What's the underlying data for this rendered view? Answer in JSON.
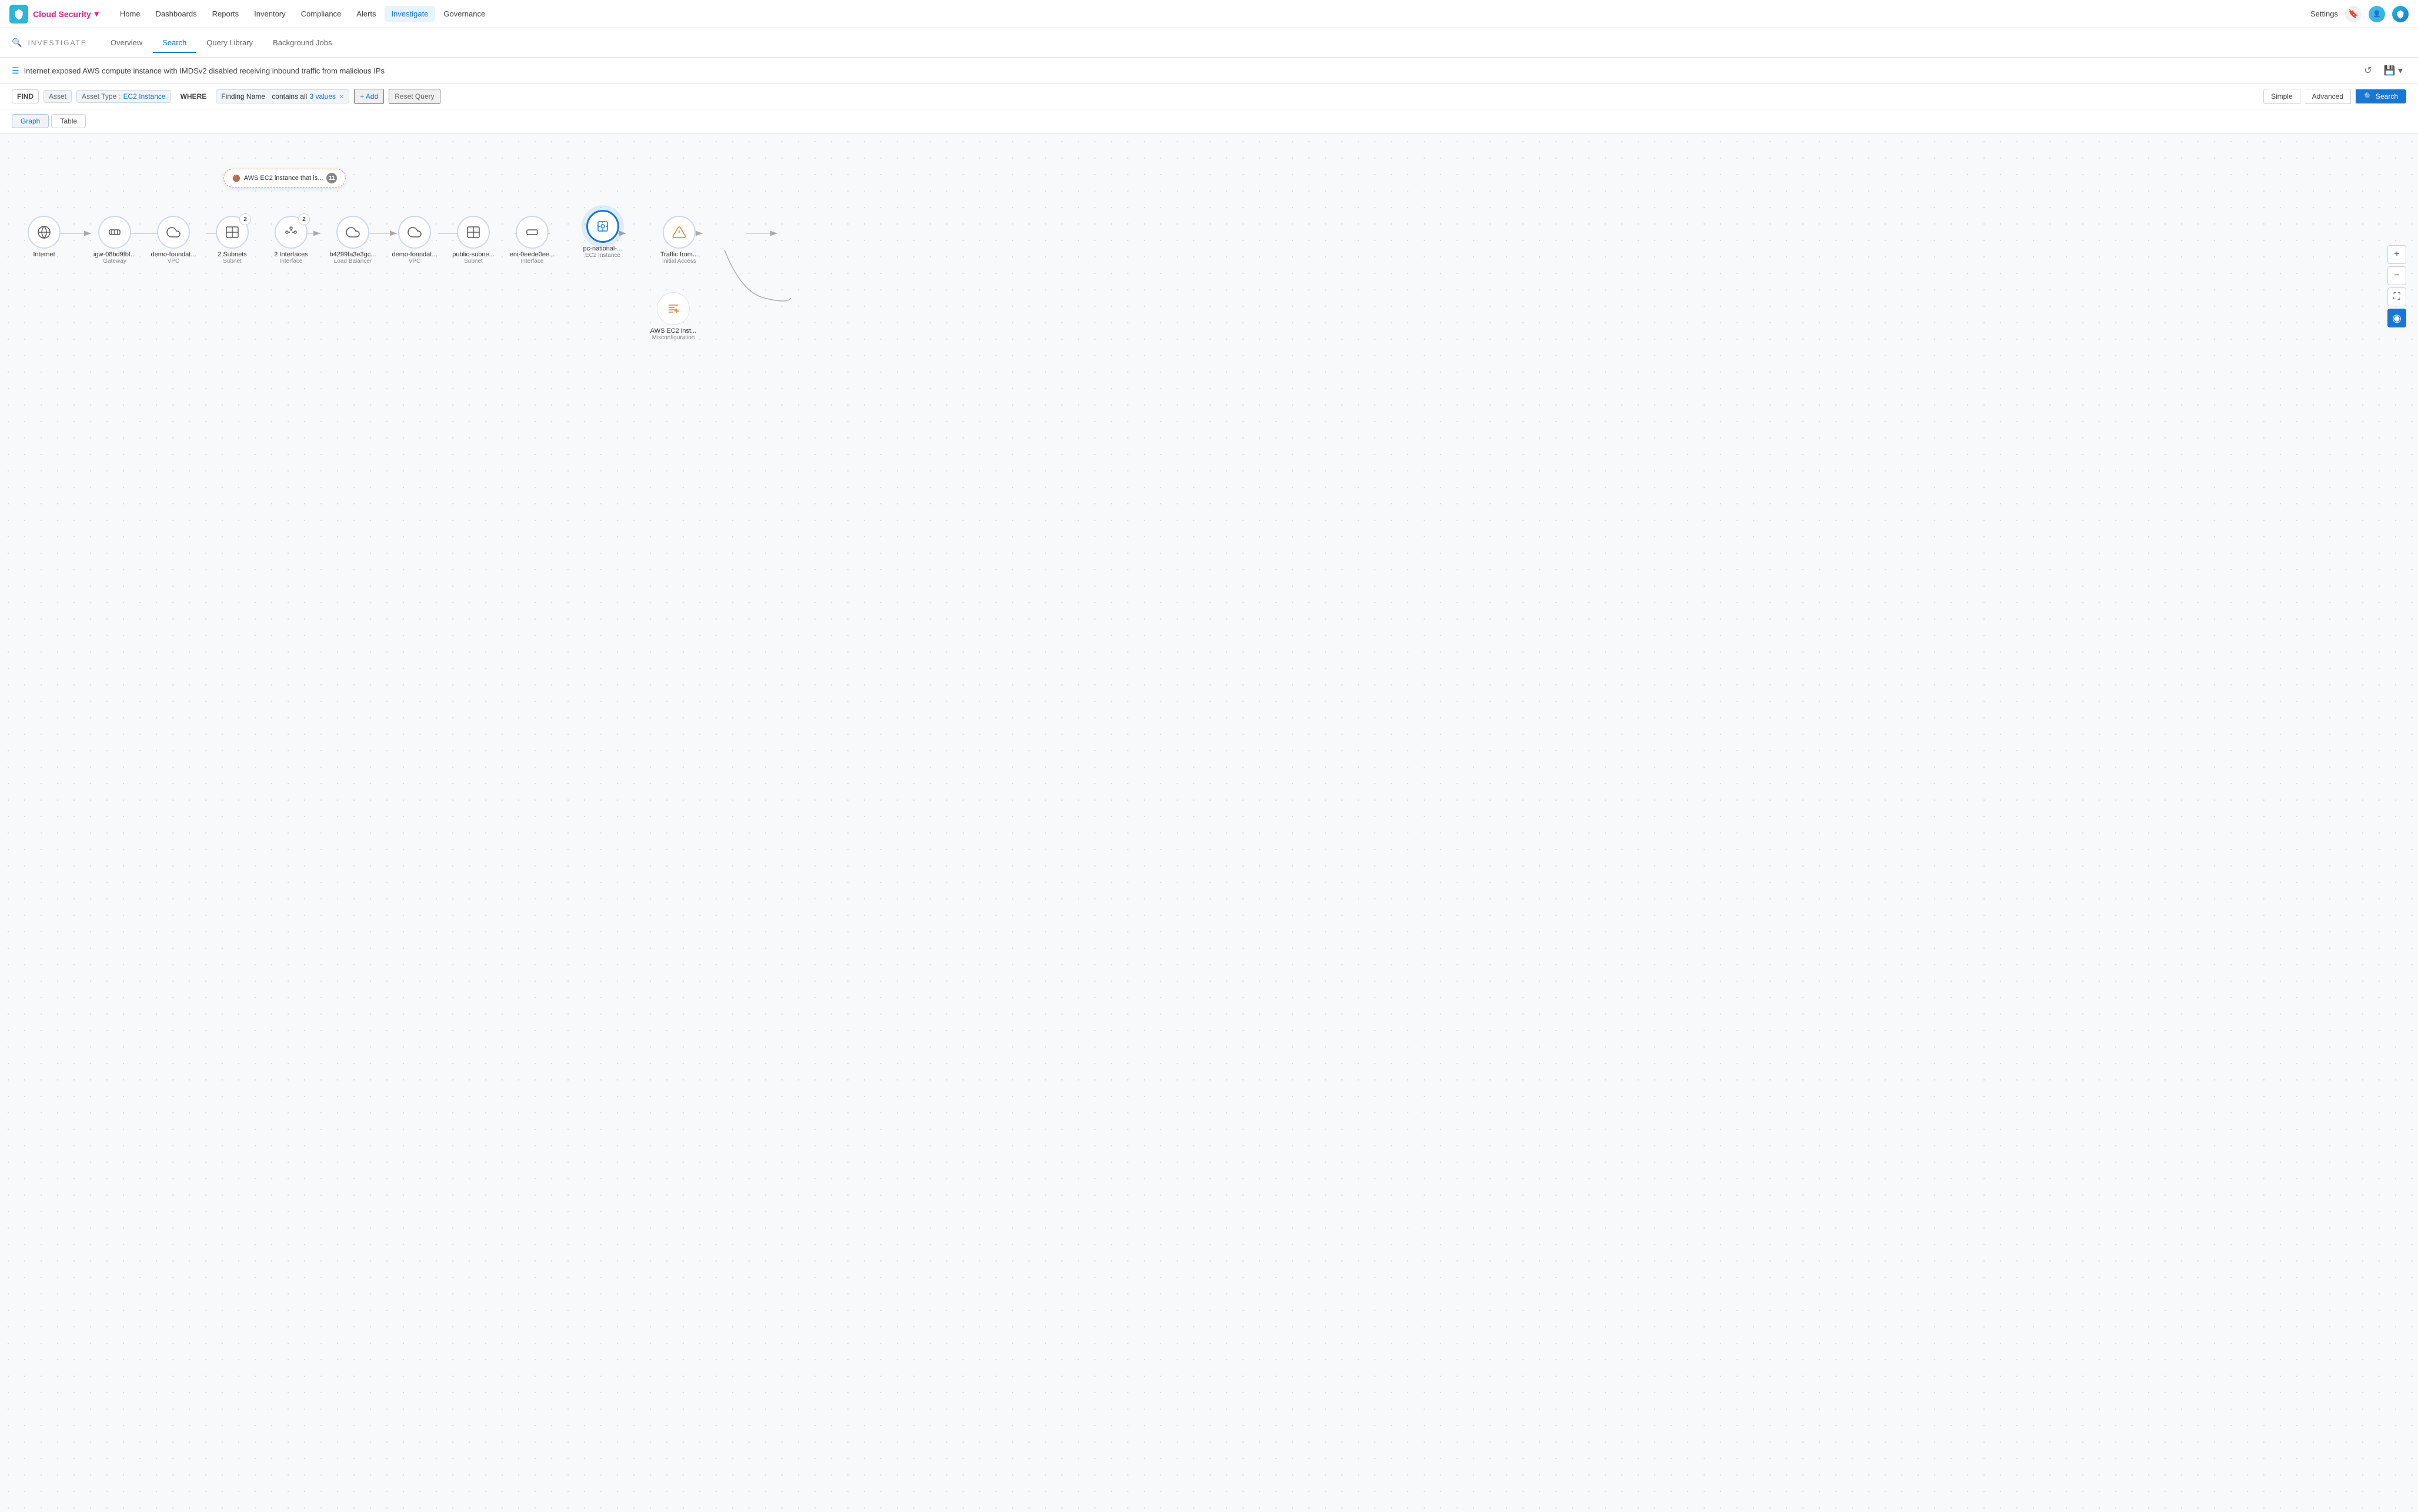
{
  "nav": {
    "brand": "Cloud Security",
    "brand_arrow": "▾",
    "logo_icon": "prisma",
    "items": [
      {
        "label": "Home",
        "active": false
      },
      {
        "label": "Dashboards",
        "active": false
      },
      {
        "label": "Reports",
        "active": false
      },
      {
        "label": "Inventory",
        "active": false
      },
      {
        "label": "Compliance",
        "active": false
      },
      {
        "label": "Alerts",
        "active": false
      },
      {
        "label": "Investigate",
        "active": true
      },
      {
        "label": "Governance",
        "active": false
      }
    ],
    "settings_label": "Settings",
    "bookmark_icon": "bookmark",
    "avatar_icon": "user",
    "prisma_icon": "prisma-logo"
  },
  "subnav": {
    "search_icon": "search",
    "title": "INVESTIGATE",
    "tabs": [
      {
        "label": "Overview",
        "active": false
      },
      {
        "label": "Search",
        "active": true
      },
      {
        "label": "Query Library",
        "active": false
      },
      {
        "label": "Background Jobs",
        "active": false
      }
    ]
  },
  "query_bar": {
    "icon": "list",
    "text": "Internet exposed AWS compute instance with IMDSv2 disabled receiving inbound traffic from malicious IPs",
    "undo_icon": "undo",
    "save_icon": "save",
    "dropdown_icon": "chevron-down"
  },
  "filter_bar": {
    "find_label": "FIND",
    "asset_label": "Asset",
    "asset_type_label": "Asset Type",
    "asset_type_colon": ":",
    "asset_type_value": "EC2 Instance",
    "where_label": "WHERE",
    "finding_name_label": "Finding Name",
    "contains_all_label": "contains all",
    "values_label": "3 values",
    "clear_icon": "×",
    "add_label": "+ Add",
    "reset_label": "Reset Query",
    "simple_label": "Simple",
    "advanced_label": "Advanced",
    "search_label": "Search",
    "search_icon": "search"
  },
  "view_toggle": {
    "graph_label": "Graph",
    "table_label": "Table"
  },
  "graph": {
    "tooltip": {
      "icon": "aws-ec2",
      "text": "AWS EC2 instance that is...",
      "count": "11"
    },
    "nodes": [
      {
        "id": "internet",
        "label": "Internet",
        "sublabel": "",
        "icon": "globe",
        "badge": null,
        "active": false
      },
      {
        "id": "igw",
        "label": "igw-08bd9fbf...",
        "sublabel": "Gateway",
        "icon": "gateway",
        "badge": null,
        "active": false
      },
      {
        "id": "demo-vpc1",
        "label": "demo-foundat...",
        "sublabel": "VPC",
        "icon": "cloud",
        "badge": null,
        "active": false
      },
      {
        "id": "subnets",
        "label": "2 Subnets",
        "sublabel": "Subnet",
        "icon": "network",
        "badge": "2",
        "active": false
      },
      {
        "id": "interfaces",
        "label": "2 Interfaces",
        "sublabel": "Interface",
        "icon": "interface",
        "badge": "2",
        "active": false
      },
      {
        "id": "lb",
        "label": "b4299fa3e3gc...",
        "sublabel": "Load Balancer",
        "icon": "loadbalancer",
        "badge": null,
        "active": false
      },
      {
        "id": "demo-vpc2",
        "label": "demo-foundat...",
        "sublabel": "VPC",
        "icon": "cloud",
        "badge": null,
        "active": false
      },
      {
        "id": "public-sub",
        "label": "public-subne...",
        "sublabel": "Subnet",
        "icon": "network",
        "badge": null,
        "active": false
      },
      {
        "id": "eni",
        "label": "eni-0eede0ee...",
        "sublabel": "Interface",
        "icon": "interface",
        "badge": null,
        "active": false
      },
      {
        "id": "ec2",
        "label": "pc-national-...",
        "sublabel": "EC2 Instance",
        "icon": "ec2",
        "badge": null,
        "active": true
      },
      {
        "id": "traffic",
        "label": "Traffic from...",
        "sublabel": "Initial Access",
        "icon": "traffic",
        "badge": null,
        "active": false
      }
    ],
    "finding_nodes": [
      {
        "id": "finding1",
        "label": "AWS EC2 inst...",
        "sublabel": "Misconfiguration",
        "icon": "finding"
      }
    ],
    "zoom_controls": [
      {
        "label": "+",
        "type": "normal",
        "name": "zoom-in"
      },
      {
        "label": "−",
        "type": "normal",
        "name": "zoom-out"
      },
      {
        "label": "⛶",
        "type": "normal",
        "name": "fit-screen"
      },
      {
        "label": "◎",
        "type": "blue",
        "name": "center"
      }
    ]
  }
}
